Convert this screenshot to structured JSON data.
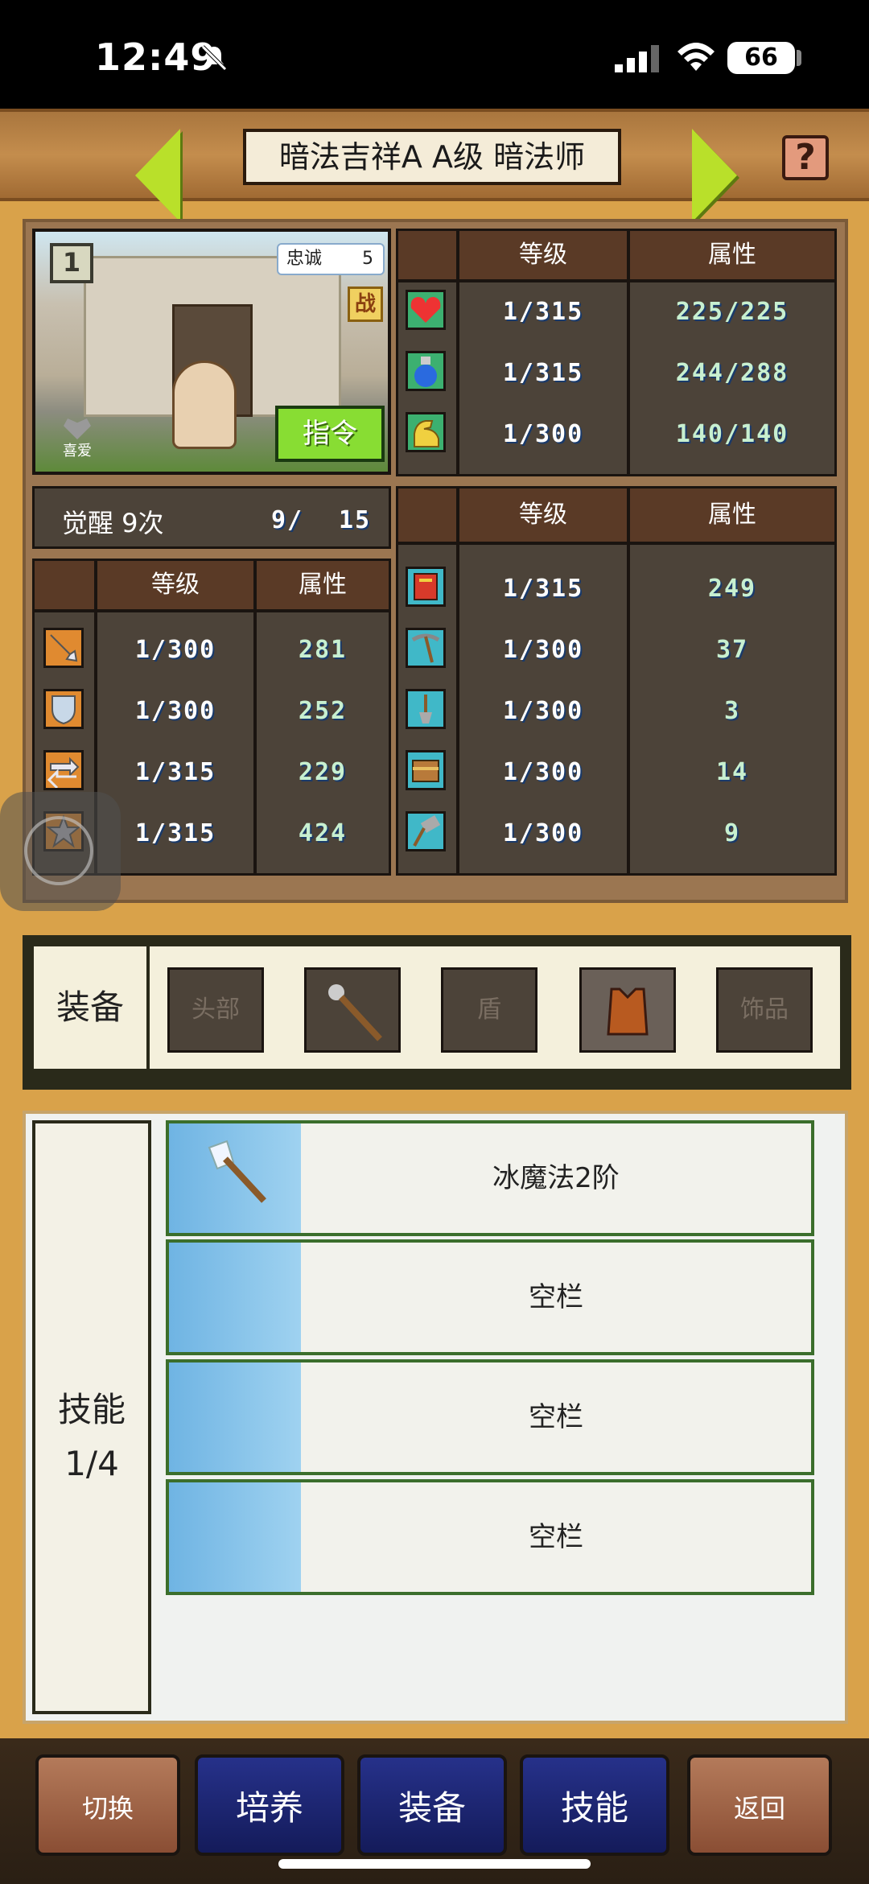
{
  "status_bar": {
    "time": "12:49",
    "battery": "66"
  },
  "header": {
    "name": "暗法吉祥A A级 暗法师",
    "help": "?"
  },
  "portrait": {
    "floor": "1",
    "loyalty_label": "忠诚",
    "loyalty_value": "5",
    "war_badge": "战",
    "order_button": "指令",
    "love_label": "喜爱"
  },
  "vitals": {
    "headers": [
      "等级",
      "属性"
    ],
    "rows": [
      {
        "icon": "heart-icon",
        "level": "1/315",
        "value": "225/225"
      },
      {
        "icon": "potion-icon",
        "level": "1/315",
        "value": "244/288"
      },
      {
        "icon": "muscle-icon",
        "level": "1/300",
        "value": "140/140"
      }
    ]
  },
  "awaken": {
    "label": "觉醒 9次",
    "progress": "9/",
    "max": "15"
  },
  "combat_left": {
    "headers": [
      "等级",
      "属性"
    ],
    "rows": [
      {
        "icon": "sword-icon",
        "level": "1/300",
        "value": "281"
      },
      {
        "icon": "shield-icon",
        "level": "1/300",
        "value": "252"
      },
      {
        "icon": "speed-icon",
        "level": "1/315",
        "value": "229"
      },
      {
        "icon": "star-icon",
        "level": "1/315",
        "value": "424"
      }
    ]
  },
  "combat_right": {
    "headers": [
      "等级",
      "属性"
    ],
    "rows": [
      {
        "icon": "book-icon",
        "level": "1/315",
        "value": "249"
      },
      {
        "icon": "pickaxe-icon",
        "level": "1/300",
        "value": "37"
      },
      {
        "icon": "shovel-icon",
        "level": "1/300",
        "value": "3"
      },
      {
        "icon": "chest-icon",
        "level": "1/300",
        "value": "14"
      },
      {
        "icon": "hammer-icon",
        "level": "1/300",
        "value": "9"
      }
    ]
  },
  "equipment": {
    "label": "装备",
    "slots": [
      "头部",
      "",
      "盾",
      "",
      "饰品"
    ]
  },
  "skills": {
    "label": "技能",
    "count": "1/4",
    "rows": [
      "冰魔法2阶",
      "空栏",
      "空栏",
      "空栏"
    ]
  },
  "bottom_nav": [
    "切换",
    "培养",
    "装备",
    "技能",
    "返回"
  ],
  "colors": {
    "accent_green": "#b9e02a",
    "panel_brown": "#4c4339",
    "nav_blue": "#26318a"
  }
}
